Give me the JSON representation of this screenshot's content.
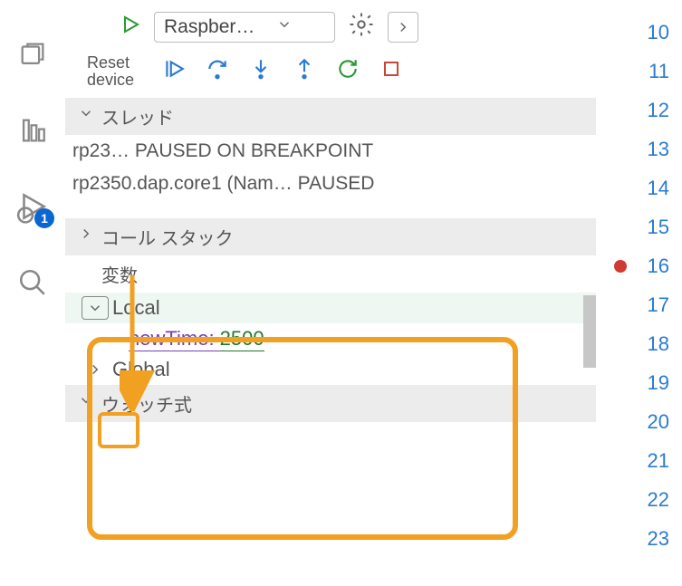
{
  "activity_bar": {
    "debug_badge": "1"
  },
  "toolbar": {
    "config_label": "Raspber…",
    "reset_label_line1": "Reset",
    "reset_label_line2": "device"
  },
  "sections": {
    "threads_title": "スレッド",
    "callstack_title": "コール スタック",
    "variables_title": "変数",
    "watch_title": "ウォッチ式"
  },
  "threads": {
    "row1": "rp23… PAUSED ON BREAKPOINT",
    "row2": "rp2350.dap.core1 (Nam… PAUSED"
  },
  "variables": {
    "local_label": "Local",
    "global_label": "Global",
    "item1_name": "nowTime",
    "item1_sep": ": ",
    "item1_value": "2500"
  },
  "gutter": {
    "10": "10",
    "11": "11",
    "12": "12",
    "13": "13",
    "14": "14",
    "15": "15",
    "16": "16",
    "17": "17",
    "18": "18",
    "19": "19",
    "20": "20",
    "21": "21",
    "22": "22",
    "23": "23"
  }
}
